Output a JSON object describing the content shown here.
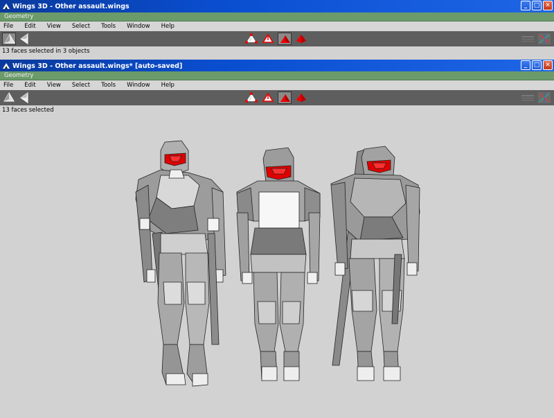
{
  "window1": {
    "title": "Wings 3D - Other assault.wings",
    "mode": "Geometry",
    "menu": [
      "File",
      "Edit",
      "View",
      "Select",
      "Tools",
      "Window",
      "Help"
    ],
    "status": "13 faces selected in 3 objects"
  },
  "window2": {
    "title": "Wings 3D - Other assault.wings* [auto-saved]",
    "mode": "Geometry",
    "menu": [
      "File",
      "Edit",
      "View",
      "Select",
      "Tools",
      "Window",
      "Help"
    ],
    "status": "13 faces selected"
  },
  "window_buttons": {
    "minimize": "_",
    "maximize": "□",
    "close": "✕"
  },
  "toolbar": {
    "left_icons": [
      "smooth-shading-icon",
      "wireframe-icon"
    ],
    "selection_modes": [
      "vertex-mode",
      "edge-mode",
      "face-mode",
      "body-mode"
    ],
    "active_mode": "face-mode",
    "right_icons": [
      "grid-icon",
      "axes-icon"
    ]
  },
  "colors": {
    "title_bar": "#0a4ed0",
    "mode_strip": "#6b9a6b",
    "toolbar": "#5e5e5e",
    "viewport": "#d2d2d2",
    "selection": "#e00000"
  }
}
